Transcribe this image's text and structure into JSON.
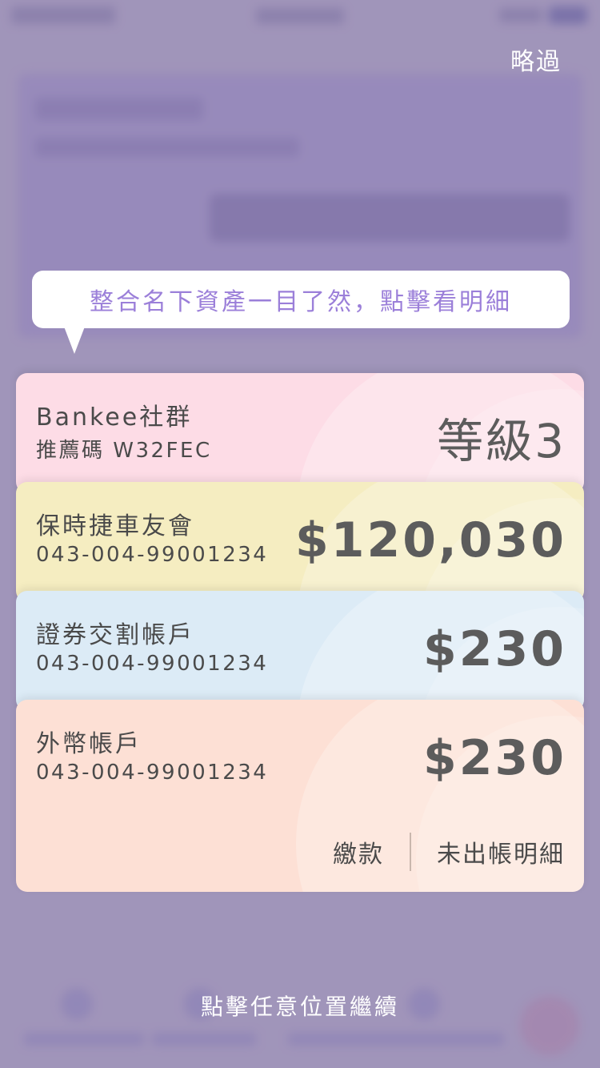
{
  "overlay": {
    "skip_label": "略過",
    "tooltip_text": "整合名下資產一目了然，點擊看明細",
    "continue_hint": "點擊任意位置繼續"
  },
  "cards": [
    {
      "name": "Bankee社群",
      "sub": "推薦碼 W32FEC",
      "value": "等級3",
      "color": "#fddce6"
    },
    {
      "name": "保時捷車友會",
      "sub": "043-004-99001234",
      "value": "$120,030",
      "color": "#f5edc1"
    },
    {
      "name": "證券交割帳戶",
      "sub": "043-004-99001234",
      "value": "$230",
      "color": "#dcebf6"
    },
    {
      "name": "外幣帳戶",
      "sub": "043-004-99001234",
      "value": "$230",
      "color": "#fde0d5"
    }
  ],
  "card_actions": {
    "pay_label": "繳款",
    "details_label": "未出帳明細"
  },
  "colors": {
    "tooltip_text": "#9b7fd9",
    "overlay": "#a79bbd",
    "hero_bg": "#8f7fc1"
  }
}
